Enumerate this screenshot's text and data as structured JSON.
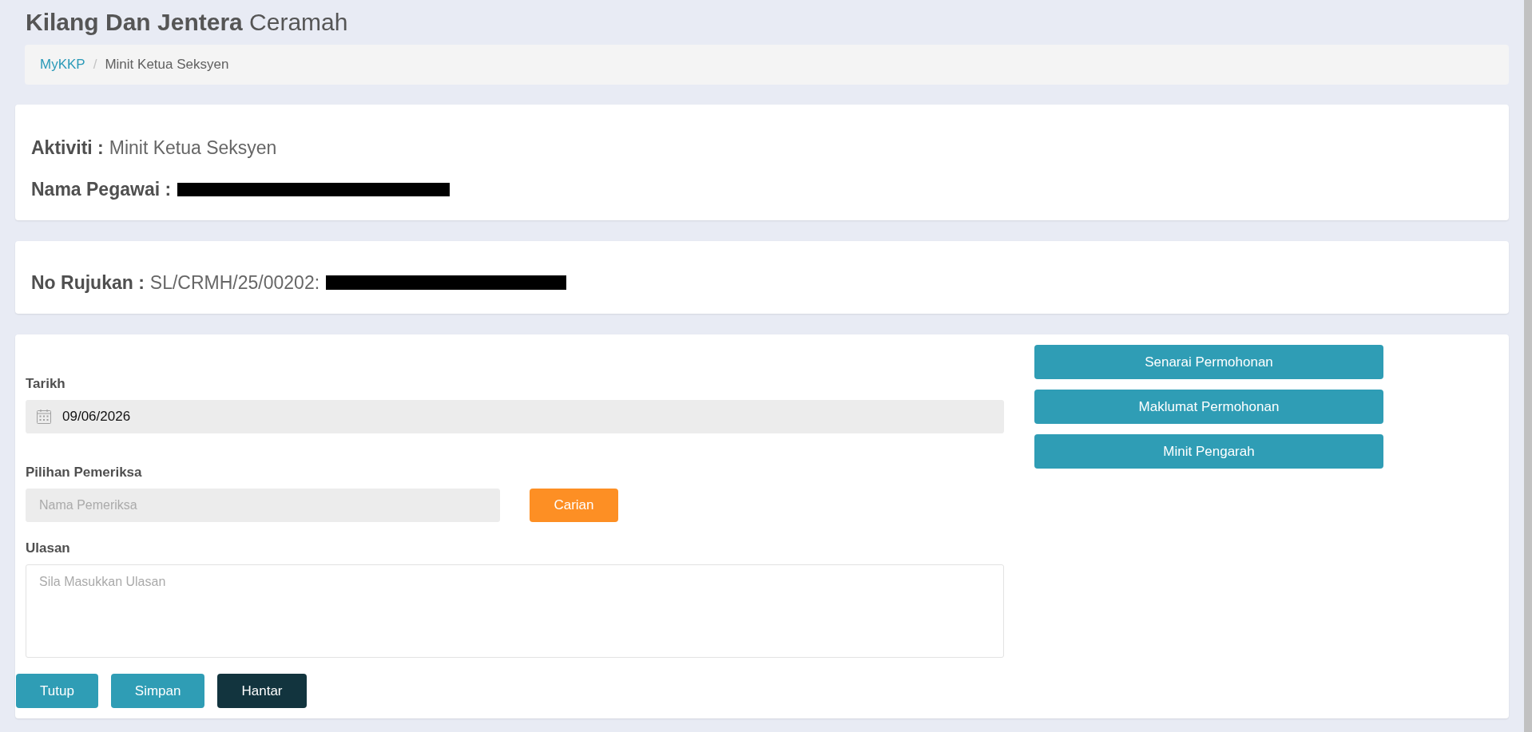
{
  "page_title": "**Kilang Dan Jentera** Ceramah",
  "breadcrumb": {
    "separator": "/",
    "items": [
      {
        "label": "MyKKP",
        "current": false
      },
      {
        "label": "Minit Ketua Seksyen",
        "current": true
      }
    ]
  },
  "info_card": {
    "fields": [
      {
        "label": "Aktiviti :",
        "value": "Minit Ketua Seksyen"
      },
      {
        "label": "Nama Pegawai :",
        "redacted": true
      }
    ]
  },
  "reference_card": {
    "fields": [
      {
        "label": "No Rujukan :",
        "value": "SL/CRMH/25/00202:",
        "redacted": true
      }
    ]
  },
  "form": {
    "date": {
      "label": "Tarikh",
      "value": "09/06/2026",
      "readonly": true
    },
    "examiner": {
      "label": "Pilihan Pemeriksa",
      "placeholder": "Nama Pemeriksa",
      "readonly": true,
      "button": "Carian"
    },
    "review": {
      "label": "Ulasan",
      "placeholder": "Sila Masukkan Ulasan",
      "readonly": false
    },
    "side_buttons": [
      "Senarai Permohonan",
      "Maklumat Permohonan",
      "Minit Pengarah"
    ],
    "actions": [
      {
        "label": "Tutup",
        "kind": "info"
      },
      {
        "label": "Simpan",
        "kind": "info"
      },
      {
        "label": "Hantar",
        "kind": "dark"
      }
    ]
  }
}
